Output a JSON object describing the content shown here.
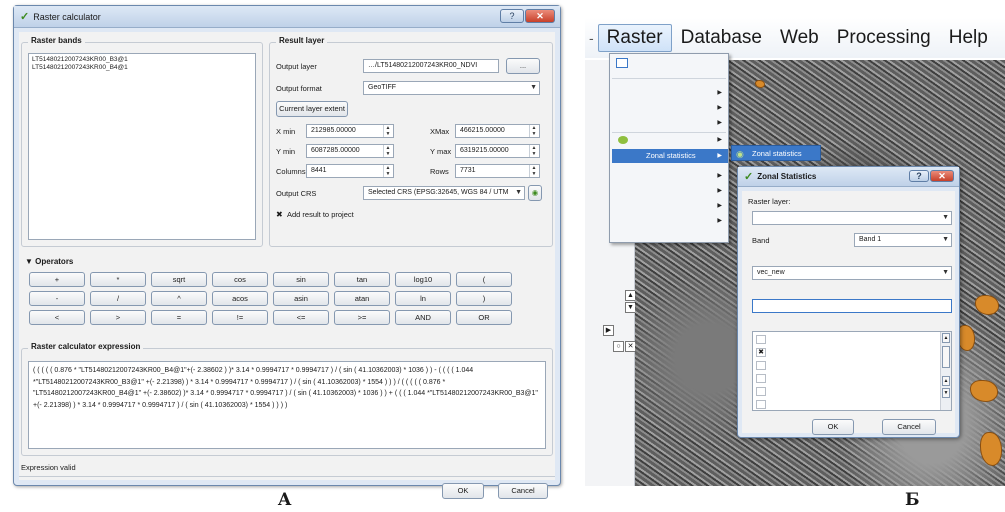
{
  "panel_a": {
    "window_title": "Raster calculator",
    "bands_group_title": "Raster bands",
    "bands": [
      "LT51480212007243KR00_B3@1",
      "LT51480212007243KR00_B4@1"
    ],
    "result_group_title": "Result layer",
    "output_layer_label": "Output layer",
    "output_layer_value": "…/LT51480212007243KR00_NDVI",
    "browse_label": "...",
    "output_format_label": "Output format",
    "output_format_value": "GeoTIFF",
    "current_extent_label": "Current layer extent",
    "xmin_label": "X min",
    "xmin_value": "212985.00000",
    "xmax_label": "XMax",
    "xmax_value": "466215.00000",
    "ymin_label": "Y min",
    "ymin_value": "6087285.00000",
    "ymax_label": "Y max",
    "ymax_value": "6319215.00000",
    "columns_label": "Columns",
    "columns_value": "8441",
    "rows_label": "Rows",
    "rows_value": "7731",
    "output_crs_label": "Output CRS",
    "output_crs_value": "Selected CRS (EPSG:32645, WGS 84 / UTM",
    "add_result_check": "✖",
    "add_result_label": "Add result to project",
    "operators_title": "▼ Operators",
    "operators": [
      "+",
      "*",
      "sqrt",
      "cos",
      "sin",
      "tan",
      "log10",
      "(",
      "-",
      "/",
      "^",
      "acos",
      "asin",
      "atan",
      "ln",
      ")",
      "<",
      ">",
      "=",
      "!=",
      "<=",
      ">=",
      "AND",
      "OR"
    ],
    "expression_title": "Raster calculator expression",
    "expression": "( ( ( ( ( 0.876 * \"LT51480212007243KR00_B4@1\"+(- 2.38602 ) )* 3.14 * 0.9994717 * 0.9994717 ) / ( sin ( 41.10362003) * 1036 ) ) - ( ( ( ( 1.044 *\"LT51480212007243KR00_B3@1\" +(- 2.21398) ) * 3.14 * 0.9994717 * 0.9994717 ) / ( sin ( 41.10362003) * 1554 ) ) ) / ( ( ( ( ( 0.876 * \"LT51480212007243KR00_B4@1\" +(- 2.38602) )* 3.14 * 0.9994717 * 0.9994717 ) / ( sin ( 41.10362003) * 1036 ) ) + ( ( ( 1.044 *\"LT51480212007243KR00_B3@1\" +(- 2.21398) ) * 3.14 * 0.9994717 * 0.9994717 ) / ( sin ( 41.10362003) * 1554 ) ) ) )",
    "status": "Expression valid",
    "ok_label": "OK",
    "cancel_label": "Cancel",
    "caption": "A"
  },
  "panel_b": {
    "menu": [
      "Raster",
      "Database",
      "Web",
      "Processing",
      "Help"
    ],
    "dropdown_highlight": "Zonal statistics",
    "submenu_item": "Zonal statistics",
    "window_title": "Zonal Statistics",
    "raster_layer_label": "Raster layer:",
    "band_label": "Band",
    "band_value": "Band 1",
    "vector_layer_value": "vec_new",
    "ok_label": "OK",
    "cancel_label": "Cancel",
    "caption": "Б"
  }
}
